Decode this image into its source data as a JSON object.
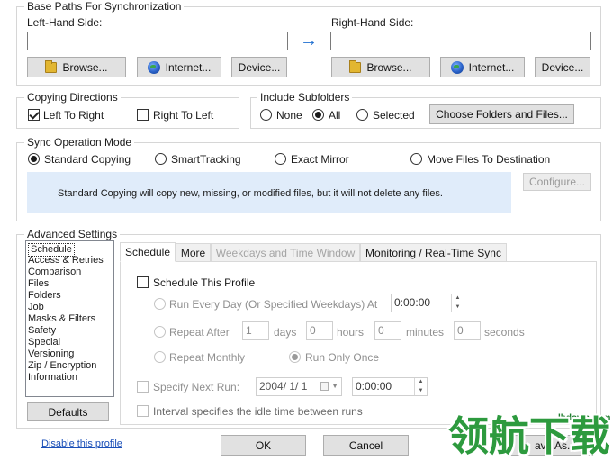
{
  "base_paths": {
    "legend": "Base Paths For Synchronization",
    "left_label": "Left-Hand Side:",
    "right_label": "Right-Hand Side:",
    "left_value": "",
    "right_value": "",
    "arrow": "→",
    "browse": "Browse...",
    "internet": "Internet...",
    "device": "Device..."
  },
  "copying": {
    "legend": "Copying Directions",
    "left_to_right": "Left To Right",
    "right_to_left": "Right To Left",
    "left_to_right_checked": true,
    "right_to_left_checked": false
  },
  "subfolders": {
    "legend": "Include Subfolders",
    "options": [
      "None",
      "All",
      "Selected"
    ],
    "selected": "All",
    "choose_button": "Choose Folders and Files..."
  },
  "sync_mode": {
    "legend": "Sync Operation Mode",
    "options": [
      "Standard Copying",
      "SmartTracking",
      "Exact Mirror",
      "Move Files To Destination"
    ],
    "selected": "Standard Copying",
    "description": "Standard Copying will copy new, missing, or modified files, but it will not delete any files.",
    "configure_button": "Configure..."
  },
  "advanced": {
    "legend": "Advanced Settings",
    "categories": [
      "Schedule",
      "Access & Retries",
      "Comparison",
      "Files",
      "Folders",
      "Job",
      "Masks & Filters",
      "Safety",
      "Special",
      "Versioning",
      "Zip / Encryption",
      "Information"
    ],
    "selected_category": "Schedule",
    "defaults_button": "Defaults",
    "tabs": [
      "Schedule",
      "More",
      "Weekdays and Time Window",
      "Monitoring / Real-Time Sync"
    ],
    "selected_tab": "Schedule"
  },
  "schedule": {
    "schedule_profile": "Schedule This Profile",
    "every_day": "Run Every Day (Or Specified Weekdays) At",
    "every_day_time": "0:00:00",
    "repeat_after": "Repeat After",
    "days_value": "1",
    "days_label": "days",
    "hours_value": "0",
    "hours_label": "hours",
    "minutes_value": "0",
    "minutes_label": "minutes",
    "seconds_value": "0",
    "seconds_label": "seconds",
    "repeat_monthly": "Repeat Monthly",
    "run_only_once": "Run Only Once",
    "specify_next_run": "Specify Next Run:",
    "next_run_date": "2004/  1/  1",
    "next_run_time": "0:00:00",
    "interval_idle": "Interval specifies the idle time between runs"
  },
  "footer": {
    "disable_profile": "Disable this profile",
    "ok": "OK",
    "cancel": "Cancel",
    "save_as": "ave As..."
  },
  "watermark": {
    "site": "lhdown.com",
    "brand": "领航下载",
    "brand_color": "#2d9a3e"
  }
}
